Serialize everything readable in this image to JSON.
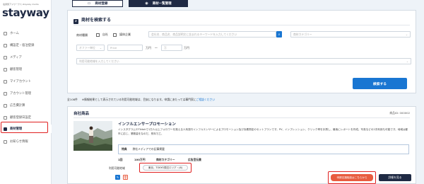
{
  "brand": {
    "tagline": "電通旅アドワークス stayway media",
    "logo": "stayway"
  },
  "sidebar": {
    "items": [
      {
        "label": "ホーム",
        "icon": "home-icon"
      },
      {
        "label": "構設定・宿泊登録",
        "icon": "building-icon"
      },
      {
        "label": "メディア",
        "icon": "media-icon"
      },
      {
        "label": "顧客管理",
        "icon": "customer-icon"
      },
      {
        "label": "マイアカウント",
        "icon": "user-icon"
      },
      {
        "label": "アカウント管理",
        "icon": "account-icon"
      },
      {
        "label": "広告費計算",
        "icon": "calculator-icon"
      },
      {
        "label": "顧客登録日設定",
        "icon": "calendar-icon"
      },
      {
        "label": "商材管理",
        "icon": "product-icon",
        "active": true
      },
      {
        "label": "お知らせ情報",
        "icon": "bell-icon"
      }
    ]
  },
  "tabs": {
    "register": "商材登録",
    "list": "商材一覧管理"
  },
  "search_panel": {
    "title": "商材を検索する",
    "category_label": "商材種類",
    "checkbox_own": "自社",
    "checkbox_ad": "媒体企業",
    "keyword_placeholder": "会社名、商品名、商品説明文に含まれるキーワードを入力してください",
    "category_select": "商材カテゴリー",
    "fee_select": "オファー単位",
    "price_from": "Price",
    "price_unit_1": "万円",
    "price_tilde": "〜",
    "price_to": "万",
    "price_unit_2": "万円",
    "area_placeholder": "利用可能地域を入力してください",
    "submit": "検索する"
  },
  "notes": {
    "count": "全108件",
    "text": "※情報結果として表示されている利用可能地域は、目安になります。申請にあたっては事門家に",
    "link": "ご相談ください"
  },
  "card": {
    "heading": "自社商品",
    "item_id": "商品ID: 000002",
    "title": "インフルエンサープロモーション",
    "description": "インスタグラムやTiktokで1万人以上フォロワーを抱える人気旅行インフルエンサーによるプロモーション及び効果測定のセットプランです。PV、インプレッション、クリック率を計測し、最後にレポートを作成。写真などの2次利用も可能です。地域は都市に応じ、業務量をなのだ、別料で乙、",
    "feature_label": "特典",
    "feature_value": "弊社メディアでの記事掲載",
    "count_label": "1回",
    "price_value": "100万円",
    "category_label": "商材カテゴリー",
    "category_value": "広告宣伝費",
    "area_label": "利用可能地域",
    "area_pill": "東京、TOKYO周辺エリア・(6)",
    "consult_button": "申請支援相談はこちらから",
    "detail_button": "詳細を見る"
  },
  "colors": {
    "navy": "#1f2a44",
    "blue": "#1976d2",
    "orange": "#e85c3f",
    "highlight": "#e02020"
  }
}
